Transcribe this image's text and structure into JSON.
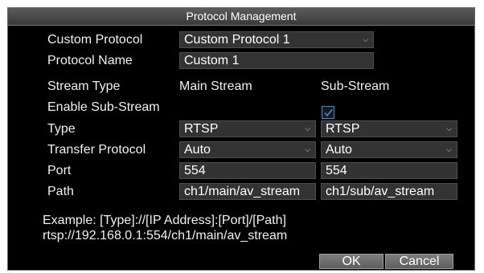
{
  "dialog": {
    "title": "Protocol Management",
    "custom_protocol": {
      "label": "Custom Protocol",
      "value": "Custom Protocol 1"
    },
    "protocol_name": {
      "label": "Protocol Name",
      "value": "Custom 1"
    },
    "stream_type": {
      "label": "Stream Type",
      "main": "Main Stream",
      "sub": "Sub-Stream"
    },
    "enable_sub_stream": {
      "label": "Enable Sub-Stream",
      "checked": true
    },
    "type": {
      "label": "Type",
      "main": "RTSP",
      "sub": "RTSP"
    },
    "transfer_protocol": {
      "label": "Transfer Protocol",
      "main": "Auto",
      "sub": "Auto"
    },
    "port": {
      "label": "Port",
      "main": "554",
      "sub": "554"
    },
    "path": {
      "label": "Path",
      "main": "ch1/main/av_stream",
      "sub": "ch1/sub/av_stream"
    },
    "example_line1": "Example: [Type]://[IP Address]:[Port]/[Path]",
    "example_line2": "rtsp://192.168.0.1:554/ch1/main/av_stream",
    "ok_label": "OK",
    "cancel_label": "Cancel"
  },
  "icons": {
    "dropdown": "chevron-down-icon",
    "check": "checkmark-icon"
  },
  "colors": {
    "background": "#000000",
    "field": "#333333",
    "checkbox_accent": "#3d8fd8"
  }
}
